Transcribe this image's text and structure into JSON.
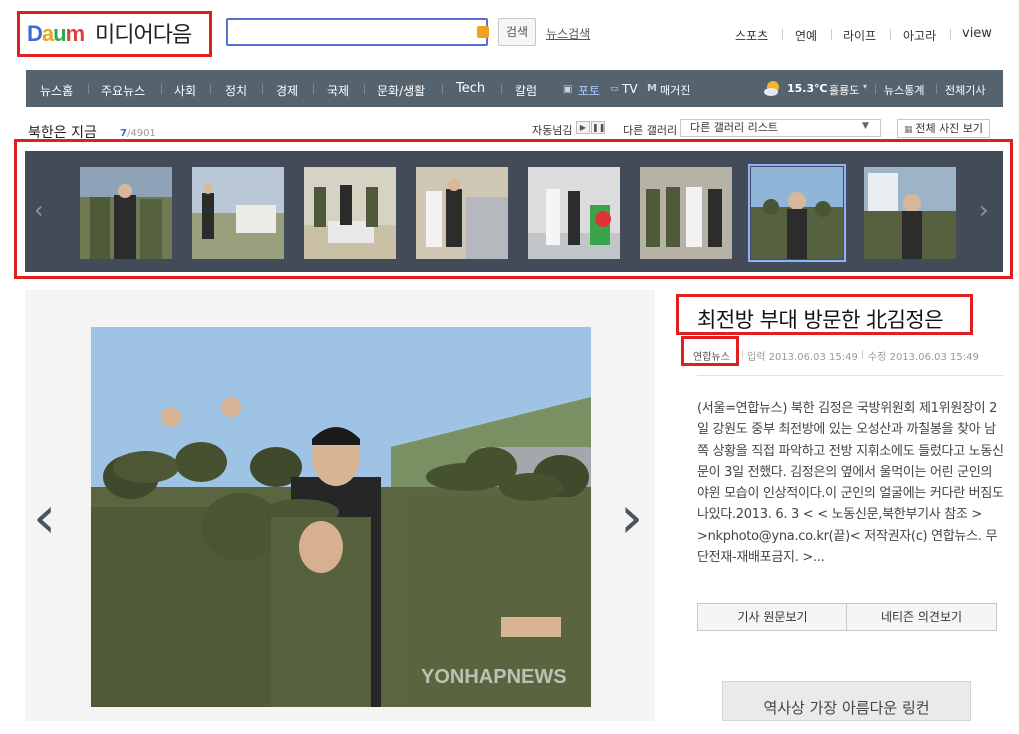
{
  "header": {
    "logo_daum": "Daum",
    "logo_media": "미디어다음",
    "search": {
      "value": "",
      "button": "검색",
      "news_search": "뉴스검색"
    },
    "top_links": [
      "스포츠",
      "연예",
      "라이프",
      "아고라",
      "view"
    ]
  },
  "nav": {
    "items": [
      "뉴스홈",
      "주요뉴스",
      "사회",
      "정치",
      "경제",
      "국제",
      "문화/생활",
      "Tech",
      "칼럼"
    ],
    "photo": "포토",
    "tv": "TV",
    "magazine": "매거진",
    "weather_temp": "15.3℃",
    "weather_loc": "홀룡도",
    "news_stats": "뉴스통계",
    "all_articles": "전체기사"
  },
  "gallery": {
    "title": "북한은 지금",
    "current": "7",
    "total": "/4901",
    "autoplay_label": "자동넘김",
    "other_gallery_label": "다른 갤러리",
    "other_gallery_select": "다른 갤러리 리스트",
    "all_photos": "전체 사진 보기",
    "selected_index": 6
  },
  "article": {
    "headline": "최전방 부대 방문한 北김정은",
    "source": "연합뉴스",
    "input_time": "입력 2013.06.03 15:49",
    "edit_time": "수정 2013.06.03 15:49",
    "body": "(서울=연합뉴스) 북한 김정은 국방위원회 제1위원장이 2일 강원도 중부 최전방에 있는 오성산과 까칠봉을 찾아 남쪽 상황을 직접 파악하고 전방 지휘소에도 들렀다고 노동신문이 3일 전했다. 김정은의 옆에서 울먹이는 어린 군인의 야윈 모습이 인상적이다.이 군인의 얼굴에는 커다란 버짐도 나있다.2013. 6. 3 < < 노동신문,북한부기사 참조 > >nkphoto@yna.co.kr(끝)< 저작권자(c) 연합뉴스. 무단전재-재배포금지. >...",
    "btn_original": "기사 원문보기",
    "btn_opinion": "네티즌 의견보기",
    "photo_watermark": "YONHAPNEWS"
  },
  "ad": {
    "text": "역사상 가장 아름다운 링컨"
  },
  "colors": {
    "highlight": "#e02020",
    "navbar": "#55636f",
    "strip": "#434b59",
    "count_accent": "#3d6bd6"
  }
}
